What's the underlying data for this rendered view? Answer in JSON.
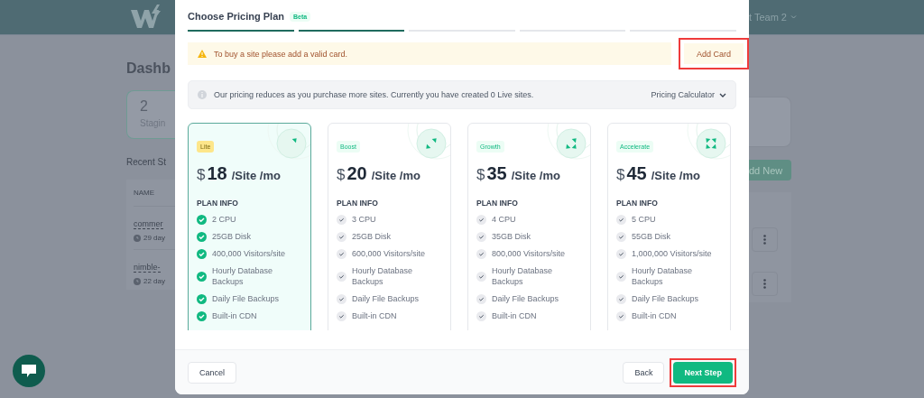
{
  "backdrop": {
    "team_menu": "t Team 2",
    "page_title": "Dashb",
    "stat": {
      "value": "2",
      "label": "Stagin"
    },
    "section_title": "Recent St",
    "add_button": "dd New",
    "table": {
      "columns": [
        "NAME"
      ],
      "rows": [
        {
          "name": "commer",
          "age": "29 day"
        },
        {
          "name": "nimble-",
          "age": "22 day"
        }
      ]
    }
  },
  "modal": {
    "title": "Choose Pricing Plan",
    "badge": "Beta",
    "steps": [
      {
        "done": true
      },
      {
        "done": true
      },
      {
        "done": false
      },
      {
        "done": false
      },
      {
        "done": false
      }
    ],
    "alert": {
      "message": "To buy a site please add a valid card.",
      "action": "Add Card",
      "highlighted": true
    },
    "info": {
      "message": "Our pricing reduces as you purchase more sites. Currently you have created 0 Live sites.",
      "action": "Pricing Calculator"
    },
    "plans": [
      {
        "name": "Lite",
        "currency": "$",
        "price": "18",
        "unit": "/Site /mo",
        "selected": true,
        "section": "PLAN INFO",
        "features": [
          "2 CPU",
          "25GB Disk",
          "400,000 Visitors/site",
          "Hourly Database Backups",
          "Daily File Backups",
          "Built-in CDN"
        ]
      },
      {
        "name": "Boost",
        "currency": "$",
        "price": "20",
        "unit": "/Site /mo",
        "selected": false,
        "section": "PLAN INFO",
        "features": [
          "3 CPU",
          "25GB Disk",
          "600,000 Visitors/site",
          "Hourly Database Backups",
          "Daily File Backups",
          "Built-in CDN"
        ]
      },
      {
        "name": "Growth",
        "currency": "$",
        "price": "35",
        "unit": "/Site /mo",
        "selected": false,
        "section": "PLAN INFO",
        "features": [
          "4 CPU",
          "35GB Disk",
          "800,000 Visitors/site",
          "Hourly Database Backups",
          "Daily File Backups",
          "Built-in CDN"
        ]
      },
      {
        "name": "Accelerate",
        "currency": "$",
        "price": "45",
        "unit": "/Site /mo",
        "selected": false,
        "section": "PLAN INFO",
        "features": [
          "5 CPU",
          "55GB Disk",
          "1,000,000 Visitors/site",
          "Hourly Database Backups",
          "Daily File Backups",
          "Built-in CDN"
        ]
      }
    ],
    "footer": {
      "cancel": "Cancel",
      "back": "Back",
      "next": {
        "label": "Next Step",
        "highlighted": true
      }
    }
  }
}
